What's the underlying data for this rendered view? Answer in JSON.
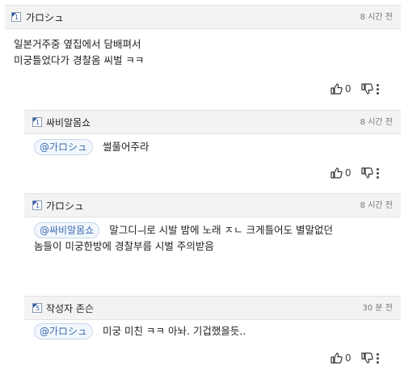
{
  "comments": [
    {
      "nickname": "가ロシュ",
      "level": "1",
      "time": "8 시간 전",
      "lines": [
        "일본거주중 옆집에서 담배펴서",
        "미궁틀었다가 경찰옴 씨벌 ㅋㅋ"
      ],
      "likes": "0"
    },
    {
      "nickname": "싸비알몸쇼",
      "level": "1",
      "time": "8 시간 전",
      "mention": "@가ロシュ",
      "lines": [
        "썰풀어주라"
      ],
      "likes": "0"
    },
    {
      "nickname": "가ロシュ",
      "level": "1",
      "time": "8 시간 전",
      "mention": "@싸비알몸쇼",
      "lines": [
        "말그디ㅢ로 시발 밤에 노래 ㅈㄴ 크게틀어도 별말없던",
        "놈들이 미궁한방에 경찰부름 시벌 주의받음"
      ],
      "likes": "0"
    },
    {
      "nickname": "작성자 존슨",
      "level": "5",
      "time": "30 분 전",
      "mention": "@가ロシュ",
      "lines": [
        "미궁 미친 ㅋㅋ 아놔. 기겁했을듯.."
      ],
      "likes": "0"
    }
  ],
  "icons": {
    "like": "thumbs-up-icon",
    "dislike": "thumbs-down-icon",
    "more": "more-vertical-icon"
  },
  "colors": {
    "header_bg": "#f3f3f3",
    "mention_text": "#3a6bb0",
    "level_icon": "#2c5aa0"
  }
}
